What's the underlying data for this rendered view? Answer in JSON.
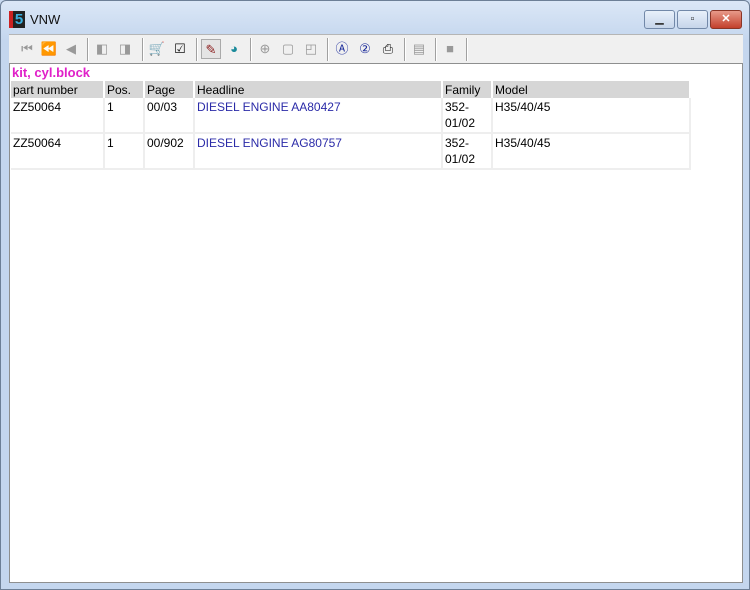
{
  "window": {
    "title": "VNW",
    "logo_text": "5"
  },
  "toolbar": {
    "buttons": [
      {
        "name": "first-record",
        "icon": "⏮",
        "enabled": false
      },
      {
        "name": "previous-page",
        "icon": "⏪",
        "enabled": false
      },
      {
        "name": "previous-record",
        "icon": "◀",
        "enabled": false
      },
      {
        "name": "back-doc",
        "icon": "◧",
        "enabled": false
      },
      {
        "name": "forward-doc",
        "icon": "◨",
        "enabled": false
      },
      {
        "name": "cart",
        "icon": "🛒",
        "enabled": true
      },
      {
        "name": "checklist",
        "icon": "☑",
        "enabled": true
      },
      {
        "name": "tools",
        "icon": "✎",
        "enabled": true
      },
      {
        "name": "globe",
        "icon": "◕",
        "enabled": true
      },
      {
        "name": "zoom",
        "icon": "⊕",
        "enabled": false
      },
      {
        "name": "page",
        "icon": "▢",
        "enabled": false
      },
      {
        "name": "page-fold",
        "icon": "◰",
        "enabled": false
      },
      {
        "name": "search-a",
        "icon": "Ⓐ",
        "enabled": true
      },
      {
        "name": "search-2",
        "icon": "②",
        "enabled": true
      },
      {
        "name": "print",
        "icon": "⎙",
        "enabled": true
      },
      {
        "name": "notes",
        "icon": "▤",
        "enabled": false
      },
      {
        "name": "stop",
        "icon": "■",
        "enabled": false
      }
    ]
  },
  "caption": "kit, cyl.block",
  "table": {
    "headers": [
      "part number",
      "Pos.",
      "Page",
      "Headline",
      "Family",
      "Model"
    ],
    "rows": [
      [
        "ZZ50064",
        "1",
        "00/03",
        "DIESEL ENGINE  AA80427",
        "352-\n01/02",
        "H35/40/45"
      ],
      [
        "ZZ50064",
        "1",
        "00/902",
        "DIESEL ENGINE  AG80757",
        "352-\n01/02",
        "H35/40/45"
      ]
    ]
  }
}
